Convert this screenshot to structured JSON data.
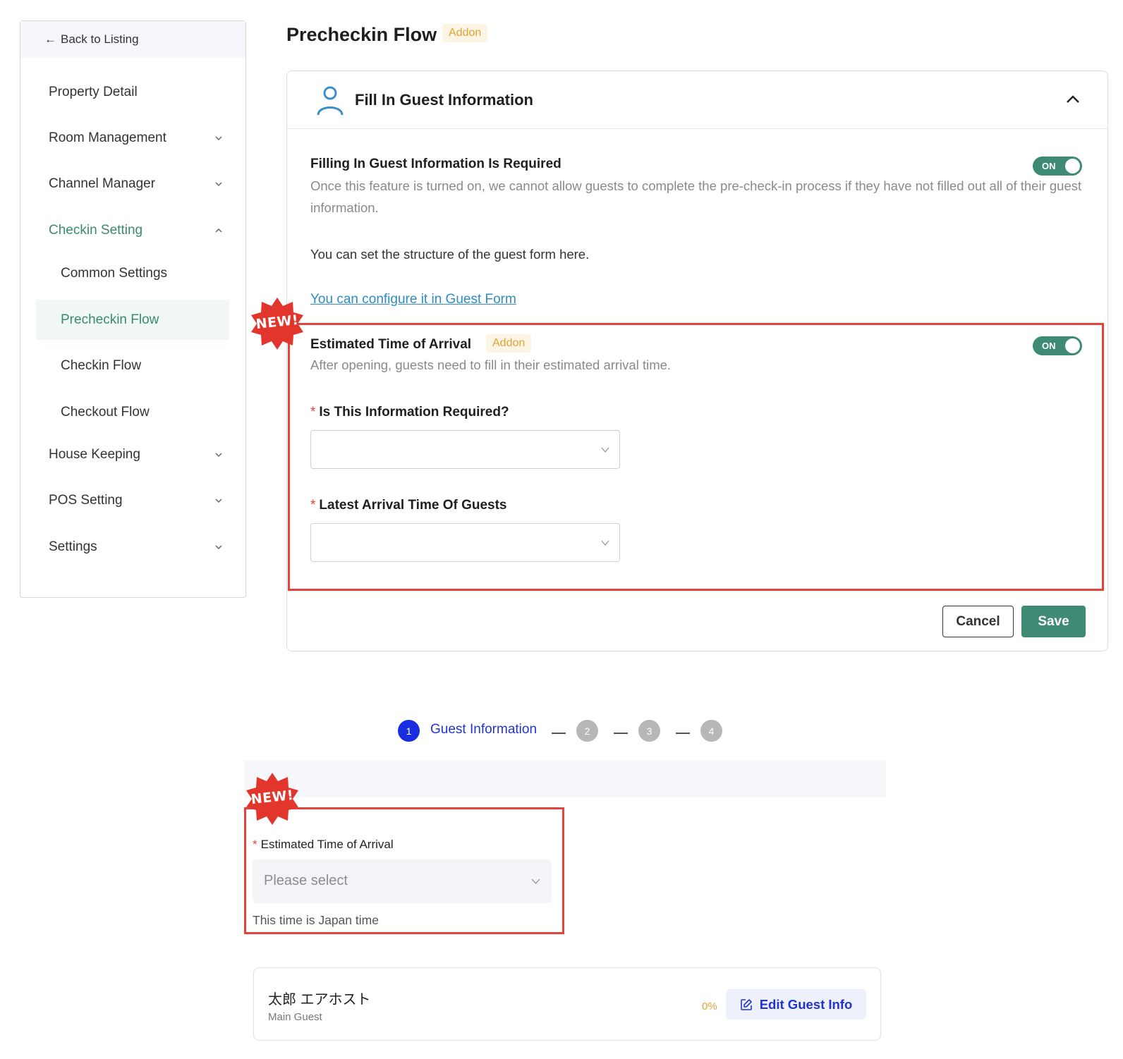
{
  "sidebar": {
    "back_label": "Back to Listing",
    "items": [
      {
        "label": "Property Detail"
      },
      {
        "label": "Room Management"
      },
      {
        "label": "Channel Manager"
      },
      {
        "label": "Checkin Setting"
      },
      {
        "label": "Common Settings"
      },
      {
        "label": "Precheckin Flow"
      },
      {
        "label": "Checkin Flow"
      },
      {
        "label": "Checkout Flow"
      },
      {
        "label": "House Keeping"
      },
      {
        "label": "POS Setting"
      },
      {
        "label": "Settings"
      }
    ]
  },
  "page": {
    "title": "Precheckin Flow",
    "addon_label": "Addon"
  },
  "card": {
    "title": "Fill In Guest Information",
    "required_section": {
      "title": "Filling In Guest Information Is Required",
      "toggle_label": "ON",
      "description": "Once this feature is turned on, we cannot allow guests to complete the pre-check-in process if they have not filled out all of their guest information.",
      "structure_note": "You can set the structure of the guest form here.",
      "link_text": "You can configure it in Guest Form"
    },
    "eta_section": {
      "new_badge": "NEW!",
      "title": "Estimated Time of Arrival",
      "addon_label": "Addon",
      "toggle_label": "ON",
      "description": "After opening, guests need to fill in their estimated arrival time.",
      "field1_label": "Is This Information Required?",
      "field1_value": "",
      "field2_label": "Latest Arrival Time Of Guests",
      "field2_value": "",
      "required_mark": "*"
    },
    "cancel_label": "Cancel",
    "save_label": "Save"
  },
  "preview": {
    "steps": [
      {
        "number": "1",
        "label": "Guest Information"
      },
      {
        "number": "2"
      },
      {
        "number": "3"
      },
      {
        "number": "4"
      }
    ],
    "new_badge": "NEW!",
    "eta_label": "Estimated Time of Arrival",
    "required_mark": "*",
    "eta_placeholder": "Please select",
    "eta_note": "This time is Japan time",
    "guest_name": "太郎 エアホスト",
    "guest_role": "Main Guest",
    "guest_progress": "0%",
    "edit_label": "Edit Guest Info"
  },
  "colors": {
    "accent_green": "#3f8a75",
    "link_blue": "#2f8cc2",
    "step_blue": "#1a2cdf",
    "highlight_red": "#e2443c",
    "addon_gold": "#e0a33b"
  }
}
